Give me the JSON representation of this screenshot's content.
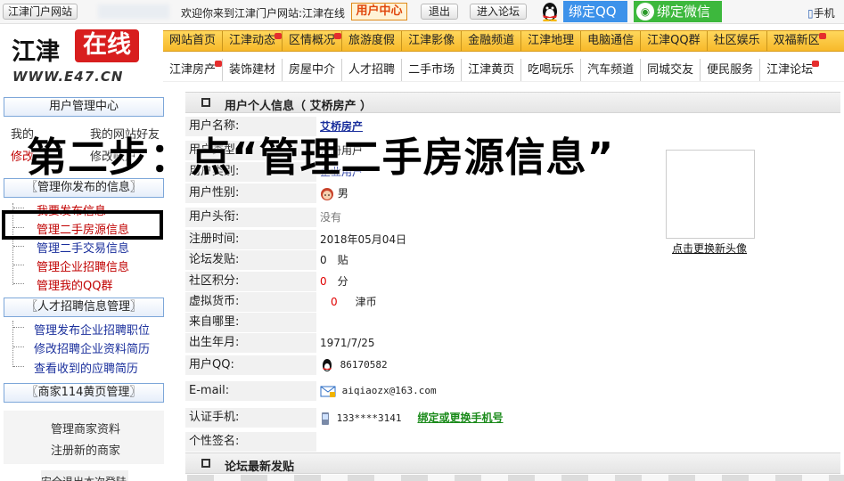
{
  "topbar": {
    "site_link": "江津门户网站",
    "welcome": "欢迎你来到江津门户网站:江津在线",
    "user_center": "用户中心",
    "logout": "退出",
    "forum": "进入论坛",
    "bind_qq": "绑定QQ",
    "bind_wechat": "绑定微信",
    "mobile": "手机"
  },
  "logo": {
    "name_black": "江津",
    "name_red": "在线",
    "url": "WWW.E47.CN"
  },
  "nav_primary": [
    "网站首页",
    "江津动态",
    "区情概况",
    "旅游度假",
    "江津影像",
    "金融频道",
    "江津地理",
    "电脑通信",
    "江津QQ群",
    "社区娱乐",
    "双福新区"
  ],
  "nav_secondary": [
    "江津房产",
    "装饰建材",
    "房屋中介",
    "人才招聘",
    "二手市场",
    "江津黄页",
    "吃喝玩乐",
    "汽车频道",
    "同城交友",
    "便民服务",
    "江津论坛"
  ],
  "sidebar": {
    "user_center_header": "用户管理中心",
    "link_row1_a": "我的",
    "link_row1_b": "我的网站好友",
    "link_row2_a": "修改",
    "link_row2_b": "修改帐户",
    "published_header": "〖管理你发布的信息〗",
    "published_items": [
      "我要发布信息",
      "管理二手房源信息",
      "管理二手交易信息",
      "管理企业招聘信息",
      "管理我的QQ群"
    ],
    "talent_header": "〖人才招聘信息管理〗",
    "talent_items": [
      "管理发布企业招聘职位",
      "修改招聘企业资料简历",
      "查看收到的应聘简历"
    ],
    "yellow_header": "〖商家114黄页管理〗",
    "yellow_items": [
      "管理商家资料",
      "注册新的商家"
    ],
    "logout_item": "安全退出本次登陆"
  },
  "profile": {
    "section_title": "用户个人信息（ 艾桥房产 ）",
    "rows": [
      {
        "label": "用户名称:",
        "value": "艾桥房产"
      },
      {
        "label": "用户类型:",
        "value": "注册用户"
      },
      {
        "label": "用户类别:",
        "value": "企业用户"
      },
      {
        "label": "用户性别:",
        "value": "男"
      },
      {
        "label": "用户头衔:",
        "value": "没有"
      },
      {
        "label": "注册时间:",
        "value": "2018年05月04日"
      },
      {
        "label": "论坛发贴:",
        "value": "0",
        "unit": "贴"
      },
      {
        "label": "社区积分:",
        "value": "0",
        "unit": "分"
      },
      {
        "label": "虚拟货币:",
        "value": "0",
        "unit": "津币"
      },
      {
        "label": "来自哪里:",
        "value": ""
      },
      {
        "label": "出生年月:",
        "value": "1971/7/25"
      },
      {
        "label": "用户QQ:",
        "value": "86170582"
      },
      {
        "label": "E-mail:",
        "value": "aiqiaozx@163.com"
      },
      {
        "label": "认证手机:",
        "value": "133****3141",
        "link": "绑定或更换手机号"
      },
      {
        "label": "个性签名:",
        "value": ""
      }
    ],
    "change_avatar": "点击更换新头像"
  },
  "forum_section_title": "论坛最新发贴",
  "overlay": "第二步：点“管理二手房源信息”",
  "colors": {
    "nav_yellow": "#f7b92a",
    "side_border": "#7da7d9",
    "link_blue": "#1a2f9c",
    "link_red": "#c00000",
    "accent_red": "#d81e1e"
  }
}
